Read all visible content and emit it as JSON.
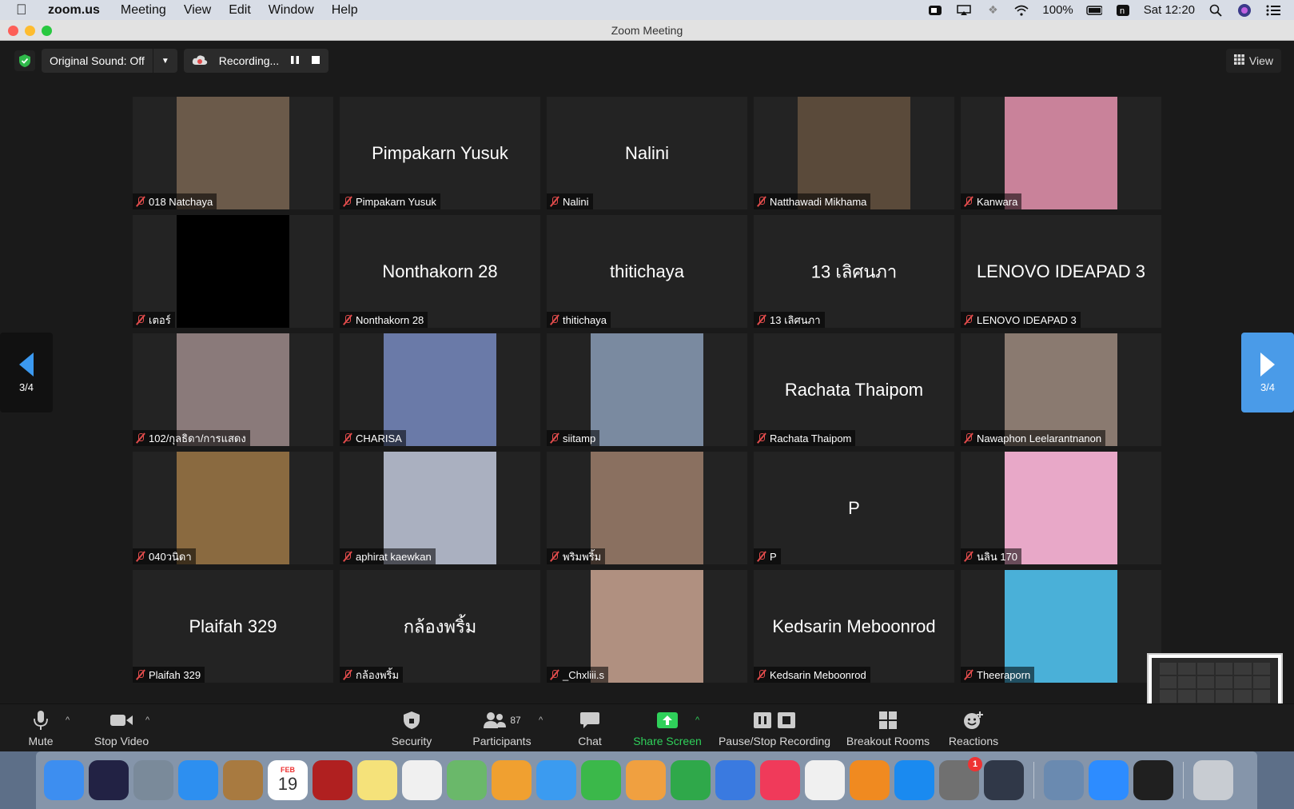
{
  "menubar": {
    "app": "zoom.us",
    "menus": [
      "Meeting",
      "View",
      "Edit",
      "Window",
      "Help"
    ],
    "battery": "100%",
    "clock": "Sat 12:20"
  },
  "window": {
    "title": "Zoom Meeting"
  },
  "topbar": {
    "original_sound": "Original Sound: Off",
    "recording": "Recording...",
    "view": "View"
  },
  "pagination": {
    "left": "3/4",
    "right": "3/4"
  },
  "tiles": [
    {
      "name": "018 Natchaya",
      "video": true,
      "color": "#6b5a4a"
    },
    {
      "name": "Pimpakarn Yusuk",
      "video": false
    },
    {
      "name": "Nalini",
      "video": false
    },
    {
      "name": "Natthawadi Mikhama",
      "video": true,
      "color": "#5a4a3a"
    },
    {
      "name": "Kanwara",
      "video": true,
      "color": "#c9829a"
    },
    {
      "name": "เตอร์",
      "video": true,
      "color": "#000000"
    },
    {
      "name": "Nonthakorn 28",
      "video": false
    },
    {
      "name": "thitichaya",
      "video": false
    },
    {
      "name": "13 เลิศนภา",
      "video": false
    },
    {
      "name": "LENOVO IDEAPAD 3",
      "video": false
    },
    {
      "name": "102/กุลธิดา/การแสดง",
      "video": true,
      "color": "#8a7a7a"
    },
    {
      "name": "CHARISA",
      "video": true,
      "color": "#6a7aa8"
    },
    {
      "name": "siitamp",
      "video": true,
      "color": "#7a8aa0"
    },
    {
      "name": "Rachata Thaipom",
      "video": false
    },
    {
      "name": "Nawaphon Leelarantnanon",
      "video": true,
      "color": "#8a7a70"
    },
    {
      "name": "040วนิดา",
      "video": true,
      "color": "#8a6a40"
    },
    {
      "name": "aphirat kaewkan",
      "video": true,
      "color": "#aab0c0"
    },
    {
      "name": "พริมพริ้ม",
      "video": true,
      "color": "#8a7060"
    },
    {
      "name": "P",
      "video": false
    },
    {
      "name": "นลิน 170",
      "video": true,
      "color": "#e8a8c8"
    },
    {
      "name": "Plaifah 329",
      "video": false
    },
    {
      "name": "กล้องพริ้ม",
      "video": false
    },
    {
      "name": "_Chxliii.s",
      "video": true,
      "color": "#b09080"
    },
    {
      "name": "Kedsarin Meboonrod",
      "video": false
    },
    {
      "name": "Theeraporn",
      "video": true,
      "color": "#4ab0d8"
    }
  ],
  "toolbar": {
    "mute": "Mute",
    "stop_video": "Stop Video",
    "security": "Security",
    "participants": "Participants",
    "participants_count": "87",
    "chat": "Chat",
    "share_screen": "Share Screen",
    "pause_stop_recording": "Pause/Stop Recording",
    "breakout_rooms": "Breakout Rooms",
    "reactions": "Reactions"
  },
  "dock": {
    "calendar_month": "FEB",
    "calendar_day": "19",
    "settings_badge": "1",
    "apps": [
      {
        "name": "finder",
        "color": "#3d8ef0"
      },
      {
        "name": "siri",
        "color": "#222244"
      },
      {
        "name": "launchpad",
        "color": "#7a8a9a"
      },
      {
        "name": "safari",
        "color": "#2d8ff0"
      },
      {
        "name": "notebook",
        "color": "#a87a40"
      },
      {
        "name": "calendar",
        "color": "#ffffff"
      },
      {
        "name": "photo-booth",
        "color": "#b02020"
      },
      {
        "name": "notes",
        "color": "#f5e27a"
      },
      {
        "name": "reminders",
        "color": "#f0f0f0"
      },
      {
        "name": "maps",
        "color": "#6ab86a"
      },
      {
        "name": "photos",
        "color": "#f0a030"
      },
      {
        "name": "messages",
        "color": "#3b9bf0"
      },
      {
        "name": "facetime",
        "color": "#3bb84a"
      },
      {
        "name": "pages",
        "color": "#f0a040"
      },
      {
        "name": "numbers",
        "color": "#2fa84a"
      },
      {
        "name": "keynote",
        "color": "#3a7ae0"
      },
      {
        "name": "music",
        "color": "#f03a5a"
      },
      {
        "name": "chrome",
        "color": "#f0f0f0"
      },
      {
        "name": "books",
        "color": "#f08a20"
      },
      {
        "name": "app-store",
        "color": "#1a8af0"
      },
      {
        "name": "system-preferences",
        "color": "#707070"
      },
      {
        "name": "quicktime",
        "color": "#303848"
      },
      {
        "name": "preview",
        "color": "#6a8ab0"
      },
      {
        "name": "zoom",
        "color": "#2d8cff"
      },
      {
        "name": "piano",
        "color": "#202020"
      },
      {
        "name": "trash",
        "color": "#c8ccd2"
      }
    ]
  }
}
